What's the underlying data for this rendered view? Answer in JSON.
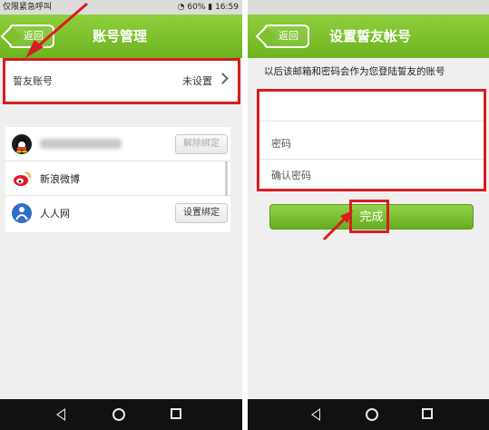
{
  "left_screen": {
    "status": {
      "carrier": "仅限紧急呼叫",
      "battery": "60%",
      "time": "16:59"
    },
    "back_label": "返回",
    "title": "账号管理",
    "friend_row": {
      "label": "誓友账号",
      "value": "未设置"
    },
    "bindings": [
      {
        "icon": "qq-icon",
        "name": "",
        "button": "解除绑定",
        "button_enabled": false
      },
      {
        "icon": "weibo-icon",
        "name": "新浪微博",
        "button": ""
      },
      {
        "icon": "renren-icon",
        "name": "人人网",
        "button": "设置绑定",
        "button_enabled": true
      }
    ]
  },
  "right_screen": {
    "back_label": "返回",
    "title": "设置誓友帐号",
    "hint": "以后该邮箱和密码会作为您登陆誓友的账号",
    "fields": [
      {
        "name": "email",
        "placeholder": ""
      },
      {
        "name": "password",
        "placeholder": "密码"
      },
      {
        "name": "confirm_password",
        "placeholder": "确认密码"
      }
    ],
    "done_label": "完成"
  },
  "colors": {
    "accent_green": "#6eb321",
    "highlight_red": "#d81e1e",
    "nav_bar": "#111111"
  }
}
